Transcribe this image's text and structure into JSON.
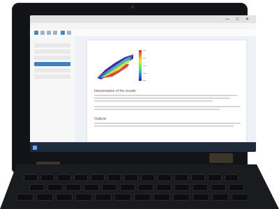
{
  "screen": {
    "titlebar": {
      "app_name": "",
      "window_title": "",
      "controls": "—  □  ✕"
    },
    "menubar": {
      "items": [
        "",
        "",
        "",
        "",
        "",
        ""
      ]
    },
    "document": {
      "section_heading": "Interpretation of the results",
      "outlook_heading": "Outlook"
    },
    "taskbar": {
      "tray_text": ""
    }
  },
  "colors": {
    "heatmap_low": "#2b1b9c",
    "heatmap_mid": "#2fd2b9",
    "heatmap_high": "#d12c22",
    "taskbar": "#1f2a3a",
    "sidebar_active": "#3f7fc8"
  }
}
